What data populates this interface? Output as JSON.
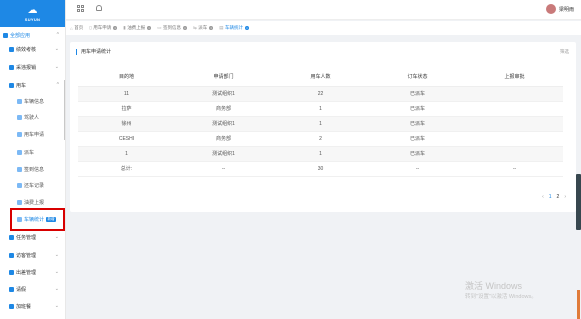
{
  "brand": {
    "text": "SUYUN",
    "logo_icon": "cloud-icon"
  },
  "sidebar": {
    "root": {
      "label": "全部应用"
    },
    "items": [
      {
        "label": "绩效考核",
        "level": 1
      },
      {
        "label": "采违报销",
        "level": 1
      },
      {
        "label": "用车",
        "level": 1
      },
      {
        "label": "车辆信息",
        "level": 2
      },
      {
        "label": "驾驶人",
        "level": 2
      },
      {
        "label": "用车申请",
        "level": 2
      },
      {
        "label": "派车",
        "level": 2
      },
      {
        "label": "签到信息",
        "level": 2
      },
      {
        "label": "还车记录",
        "level": 2
      },
      {
        "label": "油费上报",
        "level": 2
      },
      {
        "label": "车辆统计",
        "level": 2,
        "badge": "新增"
      },
      {
        "label": "任务管理",
        "level": 1
      },
      {
        "label": "访客管理",
        "level": 1
      },
      {
        "label": "出差管理",
        "level": 1
      },
      {
        "label": "请假",
        "level": 1
      },
      {
        "label": "加班餐",
        "level": 1
      }
    ]
  },
  "header": {
    "user_name": "梁明雨"
  },
  "tabs": [
    {
      "label": "首页",
      "icon": "home-icon",
      "closable": false
    },
    {
      "label": "用车申请",
      "closable": true
    },
    {
      "label": "油费上报",
      "closable": true
    },
    {
      "label": "签到信息",
      "closable": true
    },
    {
      "label": "派车",
      "closable": true
    },
    {
      "label": "车辆统计",
      "closable": true,
      "active": true
    }
  ],
  "card": {
    "title": "用车申请统计",
    "filter_label": "筛选",
    "columns": [
      "目的地",
      "申请部门",
      "用车人数",
      "订车状态",
      "上报审批"
    ],
    "rows": [
      [
        "11",
        "测试组织1",
        "22",
        "已派车",
        ""
      ],
      [
        "拉萨",
        "商务部",
        "1",
        "已派车",
        ""
      ],
      [
        "徐州",
        "测试组织1",
        "1",
        "已派车",
        ""
      ],
      [
        "CESHI",
        "商务部",
        "2",
        "已派车",
        ""
      ],
      [
        "1",
        "测试组织1",
        "1",
        "已派车",
        ""
      ],
      [
        "总计:",
        "--",
        "30",
        "--",
        "--"
      ]
    ],
    "pager": {
      "prev": "‹",
      "pages": [
        "1",
        "2"
      ],
      "next": "›",
      "current": "1"
    }
  },
  "watermark": {
    "line1": "激活 Windows",
    "line2": "转到\"设置\"以激活 Windows。"
  },
  "colors": {
    "accent": "#1e88e5",
    "highlight": "#d80000"
  }
}
